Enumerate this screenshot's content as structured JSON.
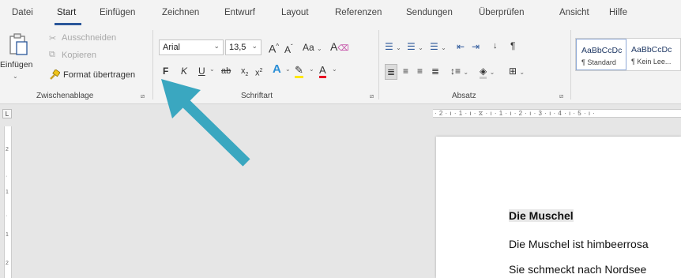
{
  "tabs": [
    "Datei",
    "Start",
    "Einfügen",
    "Zeichnen",
    "Entwurf",
    "Layout",
    "Referenzen",
    "Sendungen",
    "Überprüfen",
    "Ansicht",
    "Hilfe"
  ],
  "clipboard": {
    "paste_label": "Einfügen",
    "cut_label": "Ausschneiden",
    "copy_label": "Kopieren",
    "format_painter_label": "Format übertragen",
    "group_label": "Zwischenablage"
  },
  "font": {
    "font_name": "Arial",
    "font_size": "13,5",
    "grow_label": "A",
    "shrink_label": "A",
    "case_label": "Aa",
    "bold_label": "F",
    "italic_label": "K",
    "underline_label": "U",
    "strike_label": "ab",
    "subscript_label": "x",
    "superscript_label": "x",
    "effects_label": "A",
    "font_color_label": "A",
    "group_label": "Schriftart"
  },
  "paragraph": {
    "group_label": "Absatz"
  },
  "styles": {
    "items": [
      {
        "sample": "AaBbCcDc",
        "name": "¶ Standard"
      },
      {
        "sample": "AaBbCcDc",
        "name": "¶ Kein Lee..."
      }
    ]
  },
  "ruler": {
    "text": "· 2 · ı · 1 · ı · ⧖ · ı · 1 · ı · 2 · ı · 3 · ı · 4 · ı · 5 · ı ·",
    "tab_selector": "L"
  },
  "document": {
    "heading": "Die Muschel",
    "lines": [
      "Die Muschel ist himbeerrosa",
      "Sie schmeckt nach Nordsee"
    ]
  },
  "colors": {
    "accent": "#2b579a",
    "arrow": "#3aa7c0",
    "highlight": "#ffe800",
    "font_red": "#e81123"
  }
}
